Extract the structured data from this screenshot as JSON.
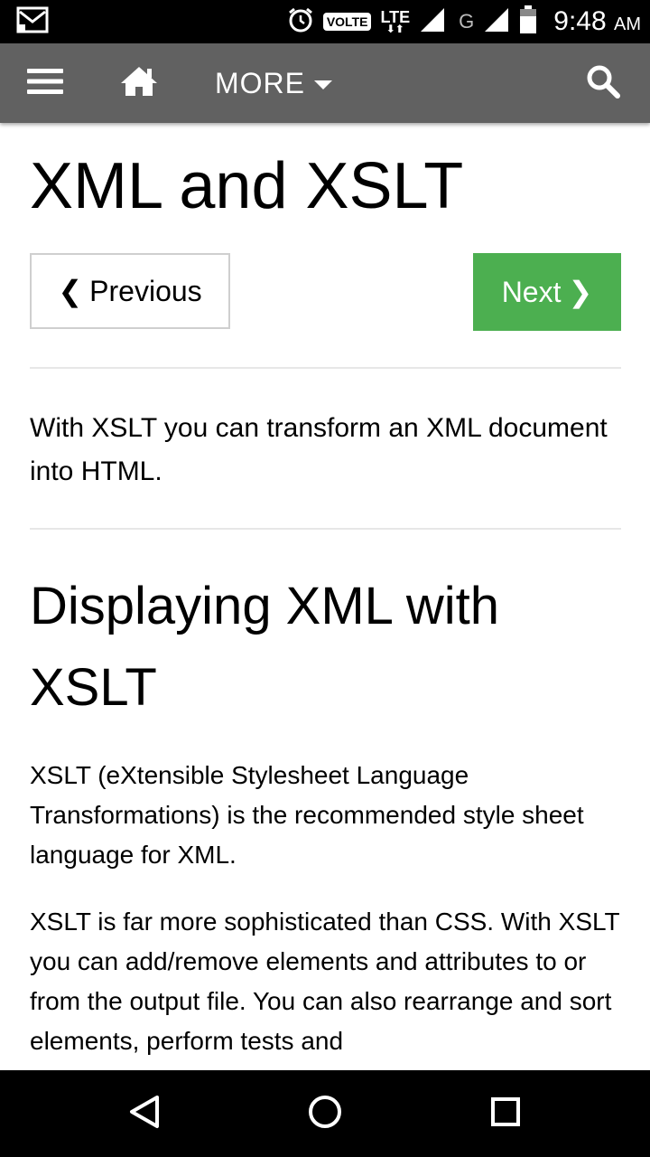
{
  "status_bar": {
    "volte": "VOLTE",
    "lte": "LTE",
    "network_g": "G",
    "time": "9:48",
    "ampm": "AM",
    "icons": [
      "gmail-icon",
      "alarm-icon",
      "signal-icon",
      "signal-icon-2",
      "battery-icon"
    ]
  },
  "appbar": {
    "more_label": "MORE",
    "icons": [
      "menu-icon",
      "home-icon",
      "caret-down-icon",
      "search-icon"
    ],
    "background": "#616161"
  },
  "page": {
    "title": "XML and XSLT",
    "prev_label": "Previous",
    "next_label": "Next",
    "next_color": "#4CAF50",
    "intro": "With XSLT you can transform an XML document into HTML.",
    "section_title": "Displaying XML with XSLT",
    "paragraphs": [
      "XSLT (eXtensible Stylesheet Language Transformations) is the recommended style sheet language for XML.",
      "XSLT is far more sophisticated than CSS. With XSLT you can add/remove elements and attributes to or from the output file. You can also rearrange and sort elements, perform tests and"
    ]
  },
  "navbar": {
    "icons": [
      "back-icon",
      "home-circle-icon",
      "recents-icon"
    ]
  }
}
